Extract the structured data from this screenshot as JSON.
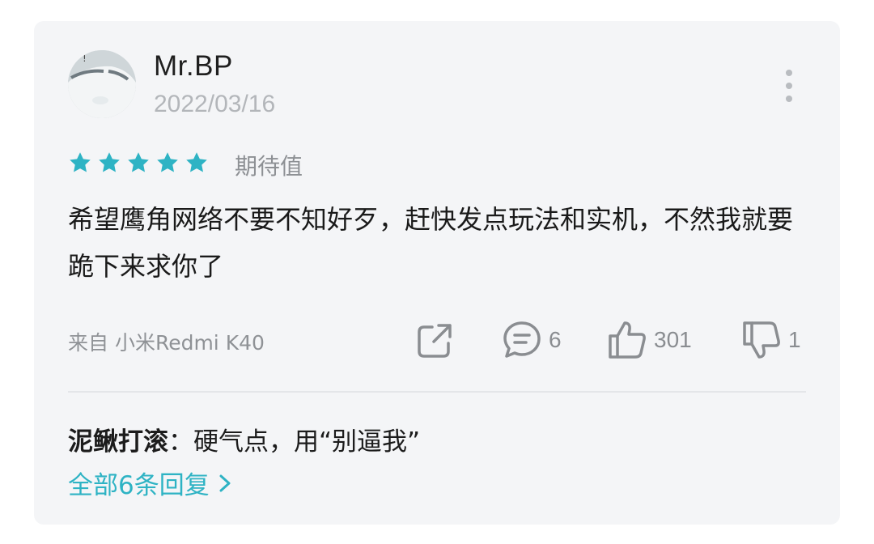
{
  "review": {
    "username": "Mr.BP",
    "date": "2022/03/16",
    "rating": 5,
    "rating_max": 5,
    "rating_label": "期待值",
    "text": "希望鹰角网络不要不知好歹，赶快发点玩法和实机，不然我就要跪下来求你了",
    "device": "来自 小米Redmi K40"
  },
  "actions": {
    "comment_count": "6",
    "like_count": "301",
    "dislike_count": "1"
  },
  "reply": {
    "author": "泥鳅打滚",
    "separator": "：",
    "text": "硬气点，用“别逼我”"
  },
  "all_replies_label": "全部6条回复",
  "colors": {
    "accent": "#2eb3c4",
    "star": "#2eb3c4",
    "card_bg": "#f4f5f7"
  },
  "icons": [
    "more-icon",
    "star-icon",
    "share-icon",
    "comment-icon",
    "thumbs-up-icon",
    "thumbs-down-icon",
    "chevron-right-icon"
  ]
}
